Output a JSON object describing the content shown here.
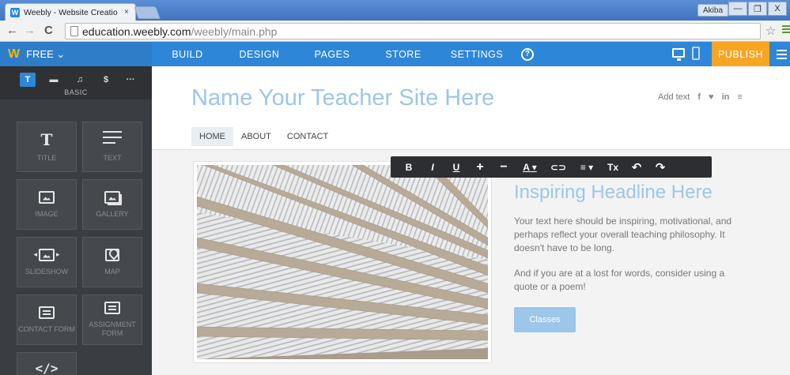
{
  "browser": {
    "tab_title": "Weebly - Website Creatio",
    "tab_close": "×",
    "user": "Akiba",
    "url_host": "education.weebly.com",
    "url_path": "/weebly/main.php",
    "nav_back": "←",
    "nav_forward": "→",
    "nav_reload": "C",
    "star": "☆",
    "window_minimize": "—",
    "window_maximize": "❐",
    "window_close": "X"
  },
  "weebly_nav": {
    "brand_logo": "W",
    "plan": "FREE ⌄",
    "items": [
      "BUILD",
      "DESIGN",
      "PAGES",
      "STORE",
      "SETTINGS"
    ],
    "help": "?",
    "publish": "PUBLISH",
    "accent": "#2d86d8",
    "publish_color": "#f8a523"
  },
  "sidebar": {
    "category_label": "BASIC",
    "category_icons": [
      "T",
      "▬",
      "♫",
      "$",
      "···"
    ],
    "elements": [
      {
        "label": "TITLE",
        "glyph": "T"
      },
      {
        "label": "TEXT"
      },
      {
        "label": "IMAGE"
      },
      {
        "label": "GALLERY"
      },
      {
        "label": "SLIDESHOW"
      },
      {
        "label": "MAP"
      },
      {
        "label": "CONTACT FORM"
      },
      {
        "label": "ASSIGNMENT FORM"
      },
      {
        "label": "",
        "glyph": "</>"
      }
    ]
  },
  "site": {
    "title": "Name Your Teacher Site Here",
    "header_add_text": "Add text",
    "social": [
      "f",
      "♥",
      "in",
      "≡"
    ],
    "nav": [
      "HOME",
      "ABOUT",
      "CONTACT"
    ],
    "headline": "Inspiring Headline Here",
    "paragraph_1": "Your text here should be inspiring, motivational, and perhaps reflect your overall teaching philosophy. It doesn't have to be long.",
    "paragraph_2": "And if you are at a lost for words, consider using a quote or a poem!",
    "button": "Classes",
    "title_color": "#9cc6ea"
  },
  "toolbar": {
    "buttons": [
      "B",
      "I",
      "U",
      "+",
      "−",
      "A ▾",
      "⊂⊃",
      "≡ ▾",
      "Tx",
      "↶",
      "↷"
    ]
  }
}
